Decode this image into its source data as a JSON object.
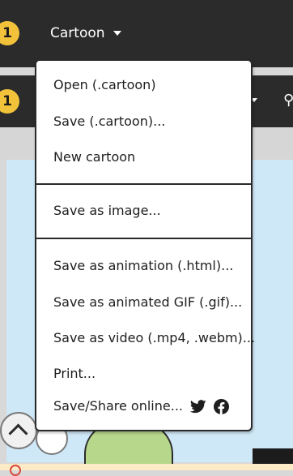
{
  "topbar": {
    "badge": "1",
    "menu_label": "Cartoon"
  },
  "toolbar2": {
    "badge": "1"
  },
  "menu": {
    "items": [
      {
        "label": "Open (.cartoon)"
      },
      {
        "label": "Save (.cartoon)..."
      },
      {
        "label": "New cartoon"
      },
      {
        "label": "Save as image..."
      },
      {
        "label": "Save as animation (.html)..."
      },
      {
        "label": "Save as animated GIF (.gif)..."
      },
      {
        "label": "Save as video (.mp4, .webm)..."
      },
      {
        "label": "Print..."
      },
      {
        "label": "Save/Share online..."
      }
    ],
    "share_icons": [
      "twitter-icon",
      "facebook-icon"
    ]
  },
  "colors": {
    "dark_bar": "#2b2b2b",
    "badge": "#f2c23a",
    "canvas_bg": "#cfe8f7",
    "menu_border": "#2a2a2a"
  }
}
